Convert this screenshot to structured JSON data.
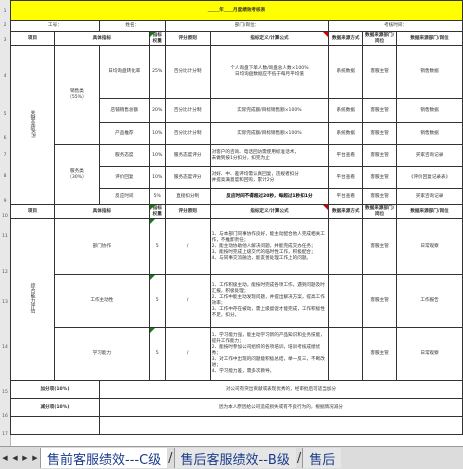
{
  "title": {
    "blank1": "_____",
    "year": "年",
    "blank2": "____",
    "text": "月度绩效考核表"
  },
  "info": {
    "emp": "工号：",
    "name": "姓名：",
    "dept": "部门/岗位：",
    "period": "考核时间："
  },
  "rownums": [
    "1",
    "2",
    "3",
    "4",
    "5",
    "6",
    "7",
    "8",
    "9",
    "10",
    "11",
    "12",
    "13",
    "14",
    "15",
    "16",
    "17"
  ],
  "header": {
    "item": "项目",
    "indicator": "具体指标",
    "weight": "指标权重",
    "scoring": "评分原则",
    "definition": "指标定义/计算公式",
    "source": "数据来源方式",
    "provider": "数据来源部门/岗位",
    "unit": "数据来源部门/岗位"
  },
  "header2": {
    "weight": "指标权重",
    "source": "数据来源方式",
    "provider": "数据来源部门/岗位",
    "unit": "数据来源部门/岗位"
  },
  "sectionA": {
    "label": "关键业绩KPI",
    "sales_label": "销售类",
    "sales_pct": "（55%）",
    "service_label": "服务类",
    "service_pct": "（30%）"
  },
  "kpi_rows": [
    {
      "name": "日均询盘转化率",
      "weight": "25%",
      "rule": "百分比计分制",
      "def": "个人询盘下单人数/询盘总人数×100%",
      "def2": "日均询盘数据应不低于每月平均值",
      "src": "系统数据",
      "dept": "客服主管",
      "unit": "销售数据"
    },
    {
      "name": "店铺销售总额",
      "weight": "20%",
      "rule": "百分比计分制",
      "def": "实际完成额/目标销售额×100%",
      "def2": "",
      "src": "系统数据",
      "dept": "客服主管",
      "unit": "销售数据"
    },
    {
      "name": "产品推荐",
      "weight": "10%",
      "rule": "百分比计分制",
      "def": "实际完成额/目标销售额×100%",
      "def2": "",
      "src": "系统数据",
      "dept": "客服主管",
      "unit": "销售数据"
    },
    {
      "name": "服务态度",
      "weight": "10%",
      "rule": "服务态度评分",
      "def": "对客户的咨询、电话回访需使用标准话术，",
      "def2": "未做到按1分扣分，扣完为止",
      "src": "平台查看",
      "dept": "客服主管",
      "unit": "买家咨询记录"
    },
    {
      "name": "评价回复",
      "weight": "10%",
      "rule": "服务态度评分",
      "def": "对好、中、差评均需认真回复，违规者扣分",
      "def2": "并提高满意度和回购，累计2分",
      "src": "平台查看",
      "dept": "客服主管",
      "unit": "《评价回复记录表》"
    },
    {
      "name": "反应时间",
      "weight": "5%",
      "rule": "直接扣分制",
      "def": "反应时间不得超过20秒，每超过1秒扣1分",
      "def2": "",
      "src": "平台查看",
      "dept": "客服主管",
      "unit": "买家咨询记录"
    }
  ],
  "sectionB": {
    "label": "综合能力评估",
    "item": "项目",
    "indicator": "具体指标",
    "weight": "指标权重",
    "scoring": "评分原则",
    "definition": "指标定义/计算公式"
  },
  "b_rows": [
    {
      "name": "部门协作",
      "weight": "5",
      "rule": "/",
      "lines": [
        "1、与本部门同事协作良好，能主动配合他人完成相关工作，不推卸责任；",
        "2、能主动协助他人解决问题，并能完成交办任务；",
        "3、能按时完成上级交代的临时性工作，积极配合；",
        "4、与同事交流融洽，能友善处理工作上的问题。"
      ],
      "dept": "客服主管",
      "unit": "日常观察"
    },
    {
      "name": "工作主动性",
      "weight": "5",
      "rule": "/",
      "lines": [
        "1、工作积极主动，能按时完成各项工作，遇到问题及时汇报，积极处理；",
        "2、工作中能主动发现问题，并提出解决方案，提高工作效率；",
        "3、工作中存在被动，需上级督促才能完成，工作积极性不足，扣分。"
      ],
      "dept": "客服主管",
      "unit": "工作报告"
    },
    {
      "name": "学习能力",
      "weight": "5",
      "rule": "/",
      "lines": [
        "1、学习能力强，能主动学习新的产品知识和业务技能，提升工作能力；",
        "2、能按时参加公司组织的各项培训，培训考核成绩优秀；",
        "3、对工作中出现的问题能积极总结，举一反三，不断改进；",
        "4、学习能力差，需多次教导。"
      ],
      "dept": "客服主管",
      "unit": "日常观察"
    }
  ],
  "bonus": {
    "add": "加分项(10%)",
    "sub": "减分项(10%)",
    "add_note": "对公司有突出贡献或表现优秀的，经审批后可适当加分",
    "sub_note": "因为本人原因给公司造成损失或有不良行为的，根据情况减分"
  },
  "tabs": [
    {
      "label": "售前客服绩效---C级",
      "active": true
    },
    {
      "label": "售后客服绩效--B级",
      "active": false
    },
    {
      "label": "售后",
      "active": false
    }
  ],
  "colors": {
    "title_fill": "#ffff00",
    "tab_text": "#1a3a8a",
    "corner_red": "#c00000",
    "corner_green": "#1a7a1a"
  }
}
